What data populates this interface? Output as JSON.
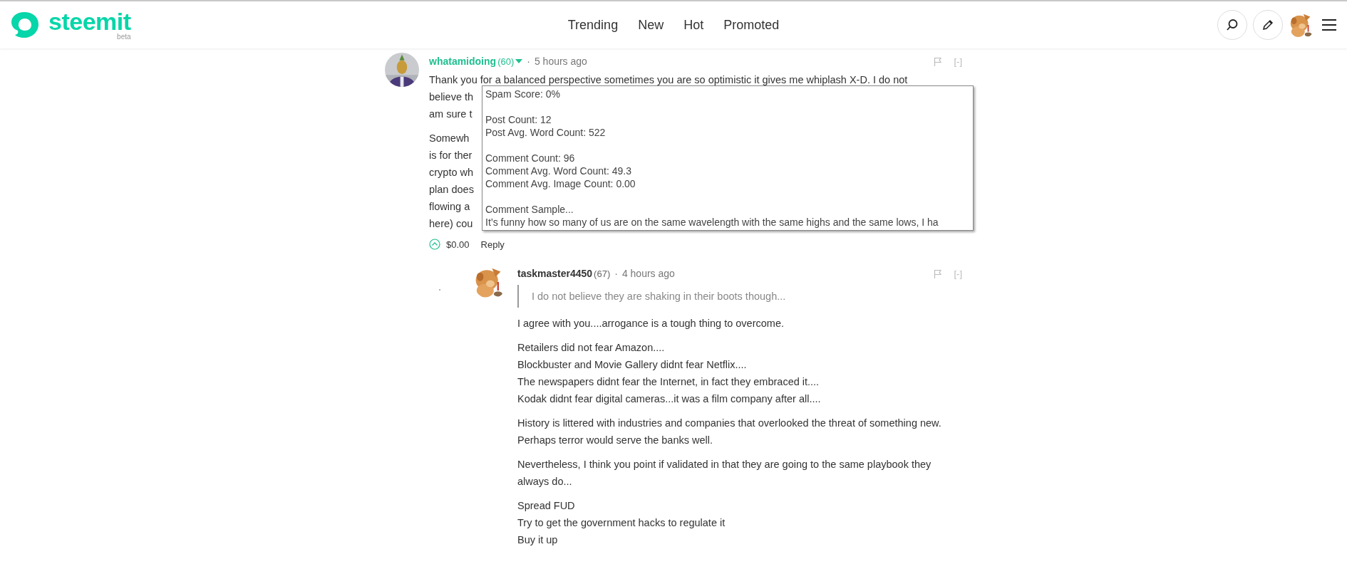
{
  "header": {
    "logo": "steemit",
    "logo_badge": "beta",
    "nav": [
      {
        "label": "Trending"
      },
      {
        "label": "New"
      },
      {
        "label": "Hot"
      },
      {
        "label": "Promoted"
      }
    ]
  },
  "comments": [
    {
      "author": "whatamidoing",
      "reputation": "(60)",
      "has_menu": true,
      "separator": "·",
      "time": "5 hours ago",
      "collapse": "[-]",
      "paragraphs": [
        [
          "Thank you for a balanced perspective sometimes you are so optimistic it gives me whiplash X-D.  I do not",
          "believe th",
          "am sure t"
        ],
        [
          "Somewh",
          "is for ther",
          "crypto wh",
          "plan does",
          "flowing a",
          "here) cou"
        ]
      ],
      "payout": "$0.00",
      "reply": "Reply",
      "tooltip": [
        [
          "Spam Score: 0%"
        ],
        [
          "Post Count: 12",
          "Post Avg. Word Count: 522"
        ],
        [
          "Comment Count: 96",
          "Comment Avg. Word Count: 49.3",
          "Comment Avg. Image Count: 0.00"
        ],
        [
          "Comment Sample...",
          "It’s  funny how so many of us are on the same wavelength with the same highs and the same lows, I ha"
        ]
      ],
      "replies": [
        {
          "author": "taskmaster4450",
          "reputation": "(67)",
          "has_menu": false,
          "separator": "·",
          "time": "4 hours ago",
          "collapse": "[-]",
          "quote": "I do not believe they are shaking in their boots though...",
          "paragraphs": [
            [
              "I agree with you....arrogance is a tough thing to overcome."
            ],
            [
              "Retailers did not fear Amazon....",
              "Blockbuster and Movie Gallery didnt fear Netflix....",
              "The newspapers didnt fear the Internet, in fact they embraced it....",
              "Kodak didnt fear digital cameras...it was a film company after all...."
            ],
            [
              "History is littered with industries and companies that overlooked the threat of something new.",
              "Perhaps terror would serve the banks well."
            ],
            [
              "Nevertheless, I think you point if validated in that they are going to the same playbook they always do..."
            ],
            [
              "Spread FUD",
              "Try to get the government hacks to regulate it",
              "Buy it up"
            ]
          ]
        }
      ]
    }
  ]
}
